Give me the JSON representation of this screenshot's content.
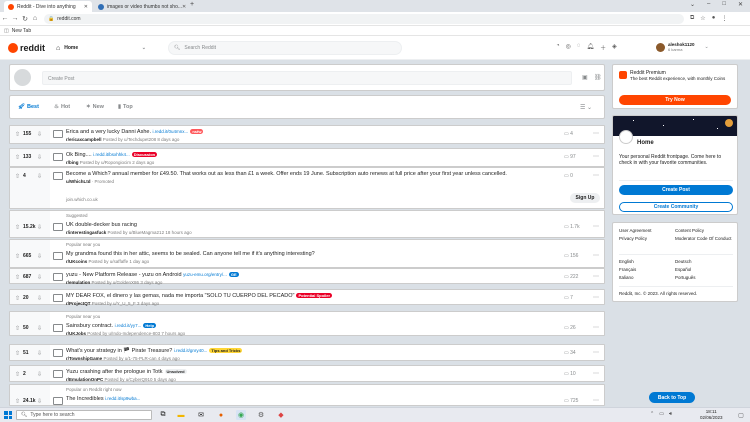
{
  "browser": {
    "tabs": [
      {
        "title": "Reddit - Dive into anything",
        "active": true
      },
      {
        "title": "images or video thumbs not sho...",
        "active": false
      }
    ],
    "new_tab": "+",
    "url": "reddit.com",
    "bookmark": "New Tab"
  },
  "header": {
    "logo": "reddit",
    "home_label": "Home",
    "search_placeholder": "Search Reddit",
    "username": "aleshok1120",
    "karma": "6 karma"
  },
  "create_post": {
    "placeholder": "Create Post"
  },
  "sort": {
    "items": [
      "Best",
      "Hot",
      "New",
      "Top"
    ],
    "active": "Best"
  },
  "posts": [
    {
      "votes": "155",
      "title": "Erica and a very lucky Danni Ashe.",
      "link": "i.redd.it/0u4mnx...",
      "flair": "nsfw",
      "flair_color": "#ff585b",
      "sub": "r/ericaxcampbell",
      "meta": "Posted by u/Techdupet208 8 days ago",
      "comments": "4"
    },
    {
      "votes": "133",
      "title": "Ok Bing....",
      "link": "i.redd.it/bsxhhk4...",
      "flair": "Discussion",
      "flair_color": "#ea0027",
      "sub": "r/bing",
      "meta": "Posted by u/Ropongiocim 2 days ago",
      "comments": "97"
    },
    {
      "votes": "4",
      "title": "Become a Which? annual member for £49.50. That works out as less than £1 a week. Offer ends 19 June. Subscription auto renews at full price after your first year unless cancelled.",
      "link": "",
      "flair": "",
      "flair_color": "",
      "sub": "u/WhichLtd",
      "meta": "· Promoted",
      "comments": "0"
    },
    {
      "votes": "15.2k",
      "suggest": "Suggested",
      "title": "UK double-decker bus racing",
      "link": "",
      "flair": "",
      "flair_color": "",
      "sub": "r/interestingasfuck",
      "meta": "Posted by u/BlueMagma212 18 hours ago",
      "comments": "1.7k"
    },
    {
      "votes": "665",
      "suggest": "Popular near you",
      "title": "My grandma found this in her attic, seems to be sealed. Can anyone tell me if it's anything interesting?",
      "link": "",
      "flair": "",
      "flair_color": "",
      "sub": "r/UKcoins",
      "meta": "Posted by u/saffaffe 1 day ago",
      "comments": "156"
    },
    {
      "votes": "687",
      "title": "yuzu - New Platform Release - yuzu on Android",
      "link": "yuzu-emu.org/entry/...",
      "flair": "GE",
      "flair_color": "#0079d3",
      "sub": "r/emulation",
      "meta": "Posted by u/GoldenX86 3 days ago",
      "comments": "222"
    },
    {
      "votes": "20",
      "title": "MY DEAR FOX, el dinero y las gemas, nada me importa \"SOLO TU CUERPO DEL PECADO\"",
      "link": "",
      "flair": "Potential Spoiler",
      "flair_color": "#ea0027",
      "sub": "r/ProjectQT",
      "meta": "Posted by u/Y_U_5_F 3 days ago",
      "comments": "7"
    },
    {
      "votes": "50",
      "suggest": "Popular near you",
      "title": "Sainsbury contract.",
      "link": "i.redd.it/yy7...",
      "flair": "Help",
      "flair_color": "#0079d3",
      "sub": "r/UKJobs",
      "meta": "Posted by u/Indo-Independence-803 7 hours ago",
      "comments": "26"
    },
    {
      "votes": "51",
      "title": "What's your strategy in 🏴 Pirate Treasure?",
      "link": "i.redd.it/gnry40...",
      "flair": "Tips and Tricks",
      "flair_color": "#ffd635",
      "sub": "r/TownshipGame",
      "meta": "Posted by u/1-75-PLR-can 4 days ago",
      "comments": "34"
    },
    {
      "votes": "2",
      "title": "Yuzu crashing after the prologue in Totk",
      "link": "",
      "flair": "Unsolved",
      "flair_color": "#edeff1",
      "sub": "r/EmulationOnPC",
      "meta": "Posted by u/CyberQ910 5 days ago",
      "comments": "10"
    },
    {
      "votes": "24.1k",
      "suggest": "Popular on Reddit right now",
      "title": "The Incredibles",
      "link": "i.redd.it/sp9wba...",
      "flair": "",
      "flair_color": "",
      "sub": "",
      "meta": "",
      "comments": "725"
    }
  ],
  "ad": {
    "url": "join.which.co.uk",
    "button": "Sign Up"
  },
  "sidebar": {
    "premium_title": "Reddit Premium",
    "premium_desc": "The best Reddit experience, with monthly Coins",
    "premium_button": "Try Now",
    "home_title": "Home",
    "home_desc": "Your personal Reddit frontpage. Come here to check in with your favorite communities.",
    "create_post_button": "Create Post",
    "create_community_button": "Create Community",
    "links_col1": [
      "User Agreement",
      "Privacy Policy"
    ],
    "links_col2": [
      "Content Policy",
      "Moderator Code Of Conduct"
    ],
    "langs_col1": [
      "English",
      "Français",
      "Italiano"
    ],
    "langs_col2": [
      "Deutsch",
      "Español",
      "Português"
    ],
    "copyright": "Reddit, Inc. © 2023. All rights reserved.",
    "back_to_top": "Back to Top"
  },
  "taskbar": {
    "search_placeholder": "Type here to search",
    "time": "18:11",
    "date": "02/06/2023"
  },
  "colors": {
    "reddit_orange": "#ff4500",
    "blue": "#0079d3"
  }
}
